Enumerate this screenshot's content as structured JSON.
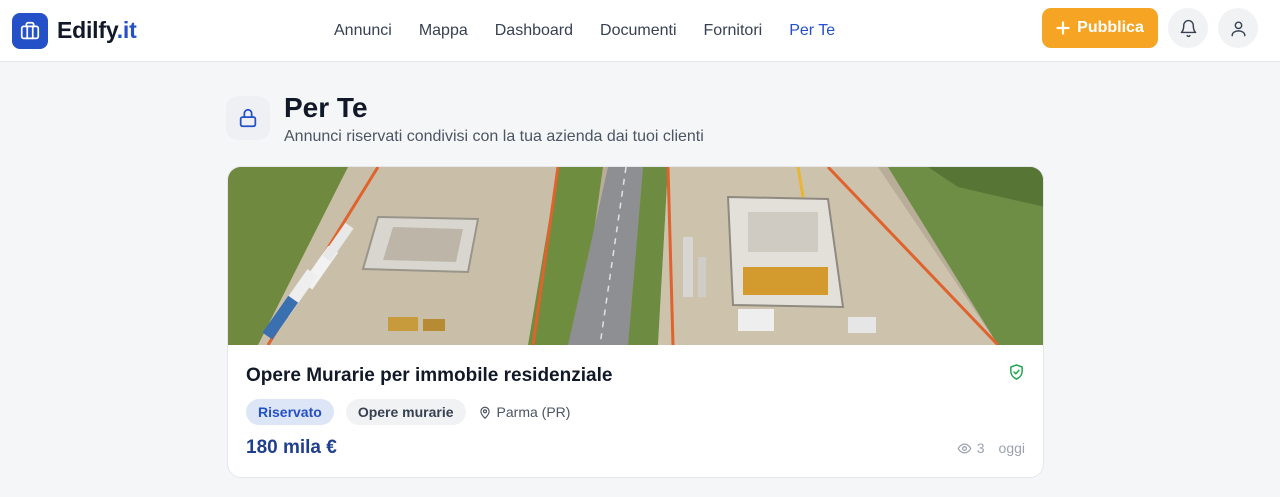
{
  "brand": {
    "name": "Edilfy",
    "tld": ".it",
    "accent": "#2450c8"
  },
  "nav": {
    "items": [
      {
        "label": "Annunci",
        "active": false
      },
      {
        "label": "Mappa",
        "active": false
      },
      {
        "label": "Dashboard",
        "active": false
      },
      {
        "label": "Documenti",
        "active": false
      },
      {
        "label": "Fornitori",
        "active": false
      },
      {
        "label": "Per Te",
        "active": true
      }
    ]
  },
  "header": {
    "publish_label": "Pubblica",
    "publish_color": "#f5a523",
    "icons": [
      "plus-icon",
      "bell-icon",
      "user-icon"
    ]
  },
  "page": {
    "title": "Per Te",
    "subtitle": "Annunci riservati condivisi con la tua azienda dai tuoi clienti",
    "icon": "lock-icon"
  },
  "listing": {
    "title": "Opere Murarie per immobile residenziale",
    "tag_reserved": "Riservato",
    "tag_category": "Opere murarie",
    "location": "Parma (PR)",
    "price": "180 mila €",
    "views": "3",
    "date": "oggi",
    "image": "aerial construction site photo"
  }
}
